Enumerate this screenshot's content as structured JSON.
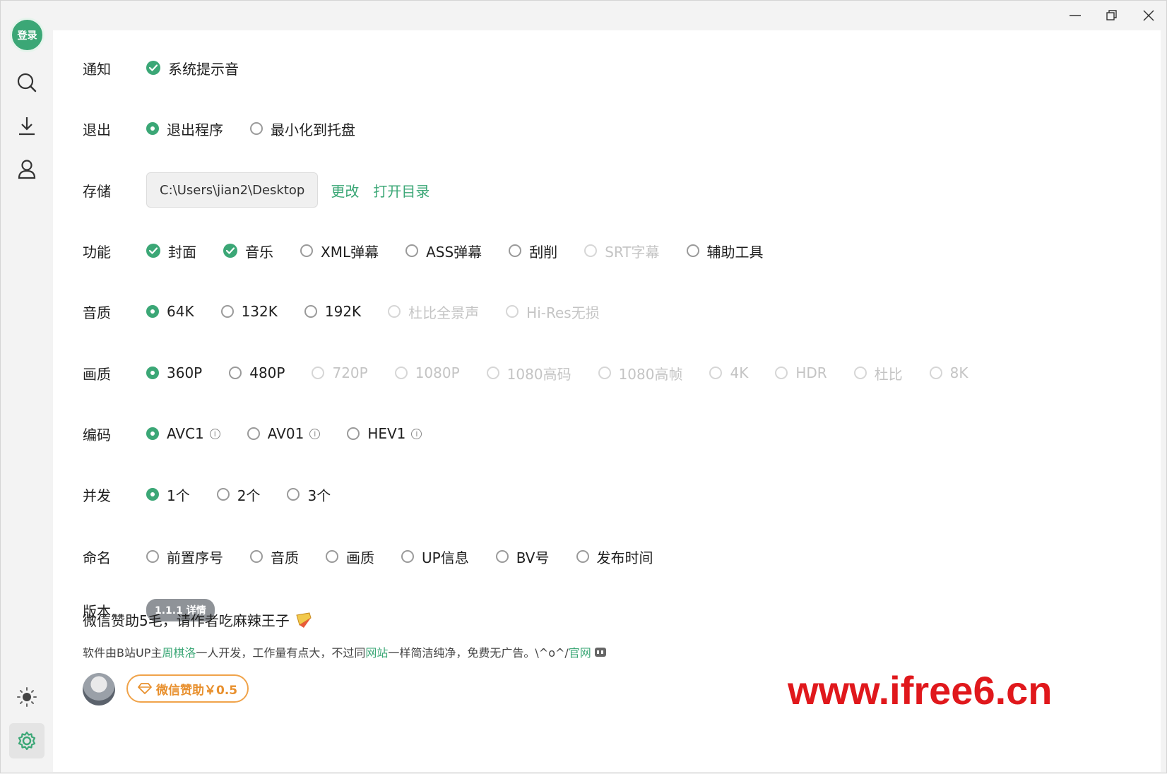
{
  "sidebar": {
    "login_label": "登录",
    "icons": [
      "search-icon",
      "download-icon",
      "user-icon",
      "theme-sun-icon",
      "settings-gear-icon"
    ]
  },
  "titlebar": {
    "minimize": "—",
    "restore": "❐",
    "close": "✕"
  },
  "settings": {
    "notify": {
      "label": "通知",
      "options": [
        {
          "text": "系统提示音",
          "state": "checked"
        }
      ]
    },
    "exit": {
      "label": "退出",
      "options": [
        {
          "text": "退出程序",
          "state": "selected"
        },
        {
          "text": "最小化到托盘",
          "state": "unselected"
        }
      ]
    },
    "storage": {
      "label": "存储",
      "path": "C:\\Users\\jian2\\Desktop",
      "change": "更改",
      "open_dir": "打开目录"
    },
    "features": {
      "label": "功能",
      "options": [
        {
          "text": "封面",
          "state": "checked"
        },
        {
          "text": "音乐",
          "state": "checked"
        },
        {
          "text": "XML弹幕",
          "state": "unselected"
        },
        {
          "text": "ASS弹幕",
          "state": "unselected"
        },
        {
          "text": "刮削",
          "state": "unselected"
        },
        {
          "text": "SRT字幕",
          "state": "disabled"
        },
        {
          "text": "辅助工具",
          "state": "unselected"
        }
      ]
    },
    "audio": {
      "label": "音质",
      "options": [
        {
          "text": "64K",
          "state": "selected"
        },
        {
          "text": "132K",
          "state": "unselected"
        },
        {
          "text": "192K",
          "state": "unselected"
        },
        {
          "text": "杜比全景声",
          "state": "disabled"
        },
        {
          "text": "Hi-Res无损",
          "state": "disabled"
        }
      ]
    },
    "video": {
      "label": "画质",
      "options": [
        {
          "text": "360P",
          "state": "selected"
        },
        {
          "text": "480P",
          "state": "unselected"
        },
        {
          "text": "720P",
          "state": "disabled"
        },
        {
          "text": "1080P",
          "state": "disabled"
        },
        {
          "text": "1080高码",
          "state": "disabled"
        },
        {
          "text": "1080高帧",
          "state": "disabled"
        },
        {
          "text": "4K",
          "state": "disabled"
        },
        {
          "text": "HDR",
          "state": "disabled"
        },
        {
          "text": "杜比",
          "state": "disabled"
        },
        {
          "text": "8K",
          "state": "disabled"
        }
      ]
    },
    "codec": {
      "label": "编码",
      "options": [
        {
          "text": "AVC1",
          "state": "selected"
        },
        {
          "text": "AV01",
          "state": "unselected"
        },
        {
          "text": "HEV1",
          "state": "unselected"
        }
      ]
    },
    "concurrency": {
      "label": "并发",
      "options": [
        {
          "text": "1个",
          "state": "selected"
        },
        {
          "text": "2个",
          "state": "unselected"
        },
        {
          "text": "3个",
          "state": "unselected"
        }
      ]
    },
    "naming": {
      "label": "命名",
      "options": [
        {
          "text": "前置序号",
          "state": "unselected"
        },
        {
          "text": "音质",
          "state": "unselected"
        },
        {
          "text": "画质",
          "state": "unselected"
        },
        {
          "text": "UP信息",
          "state": "unselected"
        },
        {
          "text": "BV号",
          "state": "unselected"
        },
        {
          "text": "发布时间",
          "state": "unselected"
        }
      ]
    },
    "version": {
      "label": "版本",
      "badge": "1.1.1 详情"
    }
  },
  "sponsor": {
    "title": "微信赞助5毛，请作者吃麻辣王子",
    "desc_1": "软件由B站UP主",
    "author": "周棋洛",
    "desc_2": "一人开发，工作量有点大，不过同",
    "site": "网站",
    "desc_3": "一样简洁纯净，免费无广告。\\^o^/",
    "official": "官网",
    "button": "微信赞助￥0.5"
  },
  "watermark": "www.ifree6.cn",
  "colors": {
    "accent": "#3ba776",
    "sponsor": "#e8902e",
    "watermark": "#e0181c"
  }
}
